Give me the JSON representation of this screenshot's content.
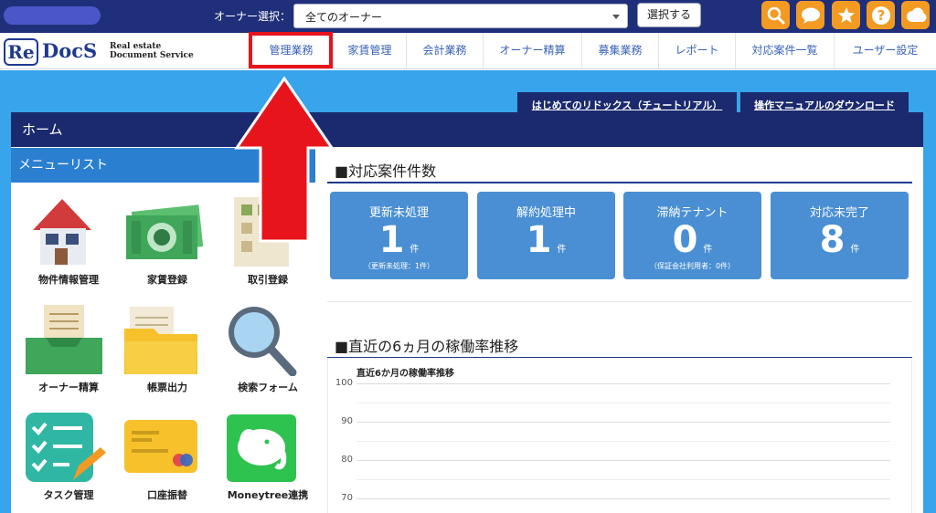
{
  "header": {
    "owner_label": "オーナー選択：",
    "owner_select_value": "全てのオーナー",
    "select_button": "選択する",
    "icons": [
      "search-icon",
      "chat-icon",
      "star-icon",
      "help-icon",
      "cloud-icon"
    ]
  },
  "logo": {
    "re": "Re",
    "docs": "DocS",
    "subtitle_line1": "Real estate",
    "subtitle_line2": "Document Service"
  },
  "nav": {
    "items": [
      "管理業務",
      "家賃管理",
      "会計業務",
      "オーナー精算",
      "募集業務",
      "レポート",
      "対応案件一覧",
      "ユーザー設定"
    ]
  },
  "tabs": {
    "tutorial": "はじめてのリドックス（チュートリアル）",
    "manual": "操作マニュアルのダウンロード"
  },
  "home": {
    "title": "ホーム"
  },
  "menu": {
    "header": "メニューリスト",
    "items": [
      "物件情報管理",
      "家賃登録",
      "取引登録",
      "オーナー精算",
      "帳票出力",
      "検索フォーム",
      "タスク管理",
      "口座振替",
      "Moneytree連携"
    ]
  },
  "cases": {
    "title": "■対応案件件数",
    "cards": [
      {
        "title": "更新未処理",
        "count": "1",
        "unit": "件",
        "sub": "（更新未処理：1件）"
      },
      {
        "title": "解約処理中",
        "count": "1",
        "unit": "件",
        "sub": ""
      },
      {
        "title": "滞納テナント",
        "count": "0",
        "unit": "件",
        "sub": "（保証会社利用者：0件）"
      },
      {
        "title": "対応未完了",
        "count": "8",
        "unit": "件",
        "sub": ""
      }
    ]
  },
  "occupancy": {
    "title": "■直近の6ヵ月の稼働率推移"
  },
  "chart_data": {
    "type": "line",
    "title": "直近6か月の稼働率推移",
    "y_ticks": [
      "100",
      "90",
      "80",
      "70"
    ],
    "ylim": [
      70,
      100
    ],
    "grid": true
  },
  "colors": {
    "topbar": "#1f2f7a",
    "page_bg": "#37a4ec",
    "accent_orange": "#f39a23",
    "card_blue": "#4a8fd3",
    "annotation_red": "#e8141c"
  }
}
